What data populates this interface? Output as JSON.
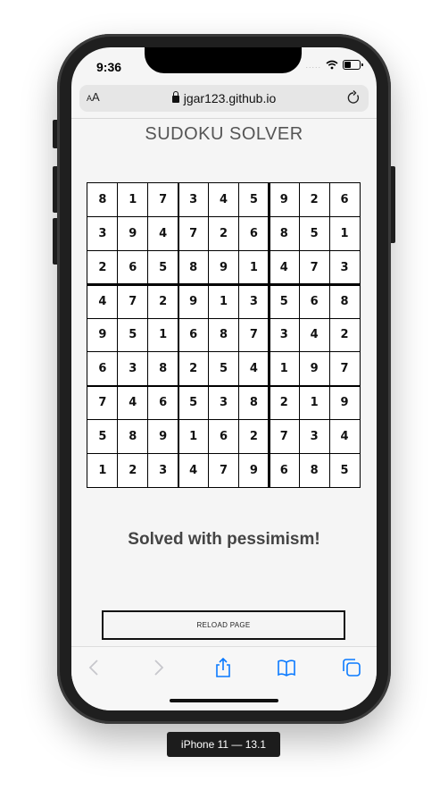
{
  "status_bar": {
    "time": "9:36",
    "signal": "....."
  },
  "browser": {
    "text_size_small": "A",
    "text_size_large": "A",
    "url": "jgar123.github.io"
  },
  "page": {
    "title": "SUDOKU SOLVER",
    "result": "Solved with pessimism!",
    "reload_label": "RELOAD PAGE"
  },
  "sudoku": {
    "rows": [
      [
        "8",
        "1",
        "7",
        "3",
        "4",
        "5",
        "9",
        "2",
        "6"
      ],
      [
        "3",
        "9",
        "4",
        "7",
        "2",
        "6",
        "8",
        "5",
        "1"
      ],
      [
        "2",
        "6",
        "5",
        "8",
        "9",
        "1",
        "4",
        "7",
        "3"
      ],
      [
        "4",
        "7",
        "2",
        "9",
        "1",
        "3",
        "5",
        "6",
        "8"
      ],
      [
        "9",
        "5",
        "1",
        "6",
        "8",
        "7",
        "3",
        "4",
        "2"
      ],
      [
        "6",
        "3",
        "8",
        "2",
        "5",
        "4",
        "1",
        "9",
        "7"
      ],
      [
        "7",
        "4",
        "6",
        "5",
        "3",
        "8",
        "2",
        "1",
        "9"
      ],
      [
        "5",
        "8",
        "9",
        "1",
        "6",
        "2",
        "7",
        "3",
        "4"
      ],
      [
        "1",
        "2",
        "3",
        "4",
        "7",
        "9",
        "6",
        "8",
        "5"
      ]
    ]
  },
  "toolbar": {
    "icons": [
      "back-icon",
      "forward-icon",
      "share-icon",
      "bookmarks-icon",
      "tabs-icon"
    ],
    "accent": "#0a7aff",
    "disabled": "#c7c7cc"
  },
  "device_label": "iPhone 11 — 13.1"
}
